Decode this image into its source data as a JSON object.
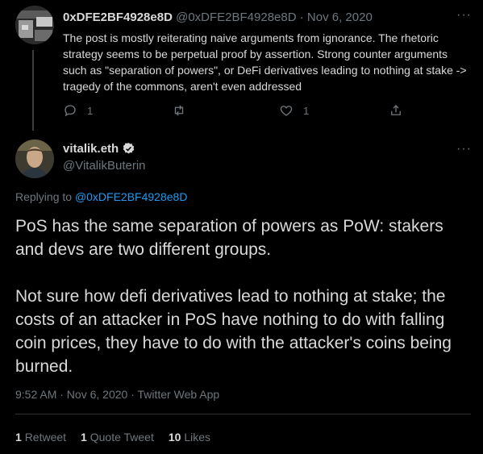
{
  "parent_tweet": {
    "display_name": "0xDFE2BF4928e8D",
    "handle": "@0xDFE2BF4928e8D",
    "separator": "·",
    "date": "Nov 6, 2020",
    "text": "The post is mostly reiterating naive arguments from ignorance. The rhetoric strategy seems to be perpetual proof by assertion. Strong counter arguments such as \"separation of powers\", or DeFi derivatives leading to nothing at stake -> tragedy of the commons, aren't even addressed",
    "reply_count": "1",
    "retweet_count": "",
    "like_count": "1",
    "icons": [
      "reply-icon",
      "retweet-icon",
      "like-icon",
      "share-icon",
      "more-icon"
    ]
  },
  "main_tweet": {
    "display_name": "vitalik.eth",
    "handle": "@VitalikButerin",
    "verified": true,
    "replying_prefix": "Replying to",
    "replying_to": "@0xDFE2BF4928e8D",
    "paragraph_1": "PoS has the same separation of powers as PoW: stakers and devs are two different groups.",
    "paragraph_2": "Not sure how defi derivatives lead to nothing at stake; the costs of an attacker in PoS have nothing to do with falling coin prices, they have to do with the attacker's coins being burned.",
    "timestamp": "9:52 AM · Nov 6, 2020 · Twitter Web App",
    "stats": {
      "retweets_count": "1",
      "retweets_label": "Retweet",
      "quote_count": "1",
      "quote_label": "Quote Tweet",
      "likes_count": "10",
      "likes_label": "Likes"
    }
  },
  "colors": {
    "background": "#000000",
    "text": "#d9d9d9",
    "muted": "#6e767d",
    "link": "#1d9bf0",
    "divider": "#2f3336"
  }
}
